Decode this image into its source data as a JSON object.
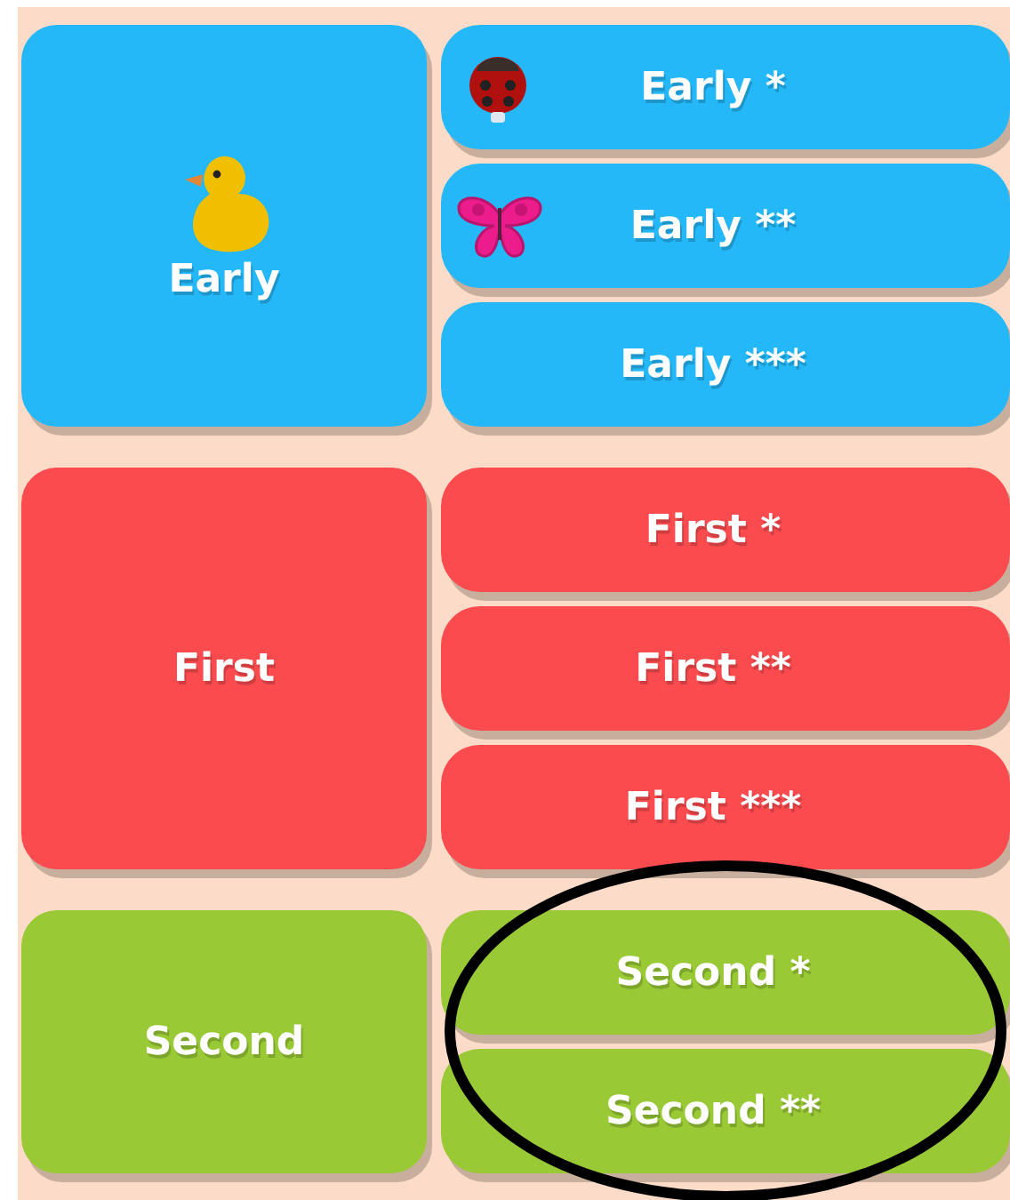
{
  "groups": [
    {
      "label": "Early",
      "color": "#24b8f8",
      "kind": "duck",
      "options": [
        {
          "label": "Early *",
          "kind": "ladybug"
        },
        {
          "label": "Early **",
          "kind": "butterfly"
        },
        {
          "label": "Early ***",
          "kind": "plain"
        }
      ]
    },
    {
      "label": "First",
      "color": "#fc4b4f",
      "kind": "plain",
      "options": [
        {
          "label": "First *",
          "kind": "plain"
        },
        {
          "label": "First **",
          "kind": "plain"
        },
        {
          "label": "First ***",
          "kind": "plain"
        }
      ]
    },
    {
      "label": "Second",
      "color": "#99c935",
      "kind": "plain",
      "options": [
        {
          "label": "Second *",
          "kind": "plain"
        },
        {
          "label": "Second **",
          "kind": "plain"
        }
      ]
    }
  ]
}
